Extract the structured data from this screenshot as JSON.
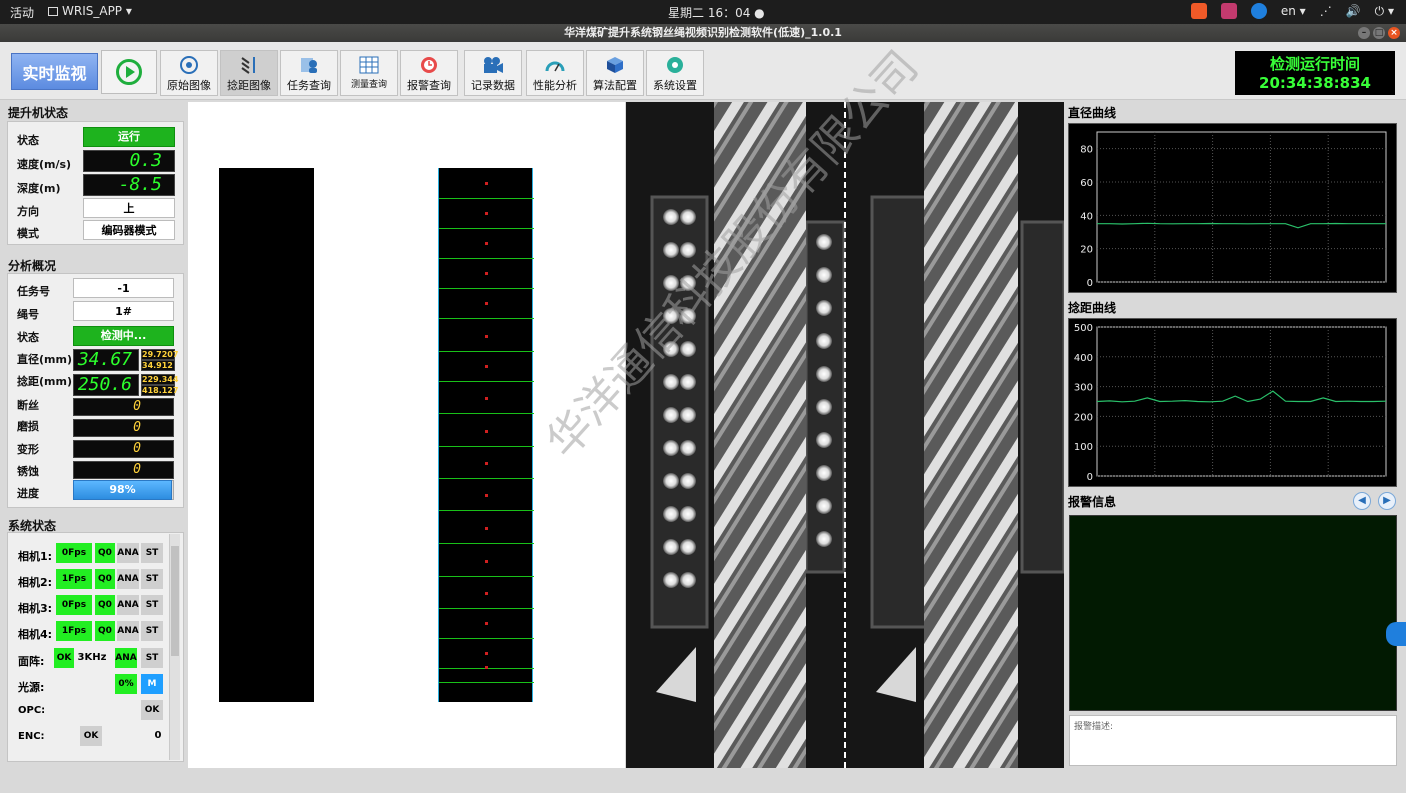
{
  "system_bar": {
    "activities": "活动",
    "app_name": "WRIS_APP ▾",
    "clock": "星期二 16：04 ●",
    "lang": "en ▾"
  },
  "window": {
    "title": "华洋煤矿提升系统钢丝绳视频识别检测软件(低速)_1.0.1"
  },
  "toolbar": {
    "live_label": "实时监视",
    "buttons": [
      {
        "label": "原始图像",
        "icon": "camera-lens-icon"
      },
      {
        "label": "捻距图像",
        "icon": "rope-pitch-icon"
      },
      {
        "label": "任务查询",
        "icon": "task-user-icon"
      },
      {
        "label": "测量查询",
        "icon": "table-grid-icon"
      },
      {
        "label": "报警查询",
        "icon": "alarm-clock-icon"
      },
      {
        "label": "记录数据",
        "icon": "video-camera-icon"
      },
      {
        "label": "性能分析",
        "icon": "gauge-icon"
      },
      {
        "label": "算法配置",
        "icon": "cube-icon"
      },
      {
        "label": "系统设置",
        "icon": "gear-icon"
      }
    ],
    "runtime_title": "检测运行时间",
    "runtime_value": "20:34:38:834"
  },
  "hoist": {
    "title": "提升机状态",
    "labels": {
      "status": "状态",
      "speed": "速度(m/s)",
      "depth": "深度(m)",
      "direction": "方向",
      "mode": "模式"
    },
    "status": "运行",
    "speed": "0.3",
    "depth": "-8.5",
    "direction": "上",
    "mode": "编码器模式"
  },
  "analysis": {
    "title": "分析概况",
    "labels": {
      "task": "任务号",
      "rope": "绳号",
      "status": "状态",
      "diameter": "直径(mm)",
      "pitch": "捻距(mm)",
      "broken": "断丝",
      "wear": "磨损",
      "deform": "变形",
      "rust": "锈蚀",
      "progress": "进度"
    },
    "task": "-1",
    "rope": "1#",
    "status": "检测中...",
    "diameter": "34.67",
    "diameter_min": "29.7207",
    "diameter_max": "34.912",
    "pitch": "250.6",
    "pitch_min": "229.344",
    "pitch_max": "418.127",
    "broken": "0",
    "wear": "0",
    "deform": "0",
    "rust": "0",
    "progress": "98%",
    "progress_value": 0.98
  },
  "system": {
    "title": "系统状态",
    "cameras": [
      {
        "label": "相机1:",
        "fps": "0Fps",
        "q": "Q0",
        "ana": "ANA",
        "st": "ST"
      },
      {
        "label": "相机2:",
        "fps": "1Fps",
        "q": "Q0",
        "ana": "ANA",
        "st": "ST"
      },
      {
        "label": "相机3:",
        "fps": "0Fps",
        "q": "Q0",
        "ana": "ANA",
        "st": "ST"
      },
      {
        "label": "相机4:",
        "fps": "1Fps",
        "q": "Q0",
        "ana": "ANA",
        "st": "ST"
      }
    ],
    "area_label": "面阵:",
    "area_ok": "OK",
    "area_freq": "3KHz",
    "area_ana": "ANA",
    "area_st": "ST",
    "light_label": "光源:",
    "light_pct": "0%",
    "light_mode": "M",
    "opc_label": "OPC:",
    "opc_ok": "OK",
    "enc_label": "ENC:",
    "enc_ok": "OK",
    "enc_value": "0"
  },
  "watermark": "华洋通信科技股份有限公司",
  "charts": {
    "diameter_title": "直径曲线",
    "pitch_title": "捻距曲线"
  },
  "chart_data": [
    {
      "type": "line",
      "title": "直径曲线",
      "ylim": [
        0,
        90
      ],
      "yticks": [
        "0",
        "20",
        "40",
        "60",
        "80"
      ],
      "grid": true,
      "series": [
        {
          "values": [
            35,
            35,
            34.8,
            35,
            35.2,
            35,
            34.9,
            35,
            35,
            35.1,
            35,
            35,
            34.9,
            35,
            35,
            35,
            32.5,
            35,
            35,
            35.1,
            35,
            35,
            35,
            35
          ]
        }
      ]
    },
    {
      "type": "line",
      "title": "捻距曲线",
      "ylim": [
        0,
        500
      ],
      "yticks": [
        "0",
        "100",
        "200",
        "300",
        "400",
        "500"
      ],
      "grid": true,
      "series": [
        {
          "values": [
            250,
            252,
            249,
            251,
            262,
            250,
            251,
            253,
            250,
            249,
            251,
            268,
            250,
            258,
            285,
            251,
            250,
            250,
            262,
            250,
            251,
            250,
            250,
            251
          ]
        }
      ]
    }
  ],
  "alarm": {
    "title": "报警信息",
    "desc_placeholder": "报警描述:"
  }
}
